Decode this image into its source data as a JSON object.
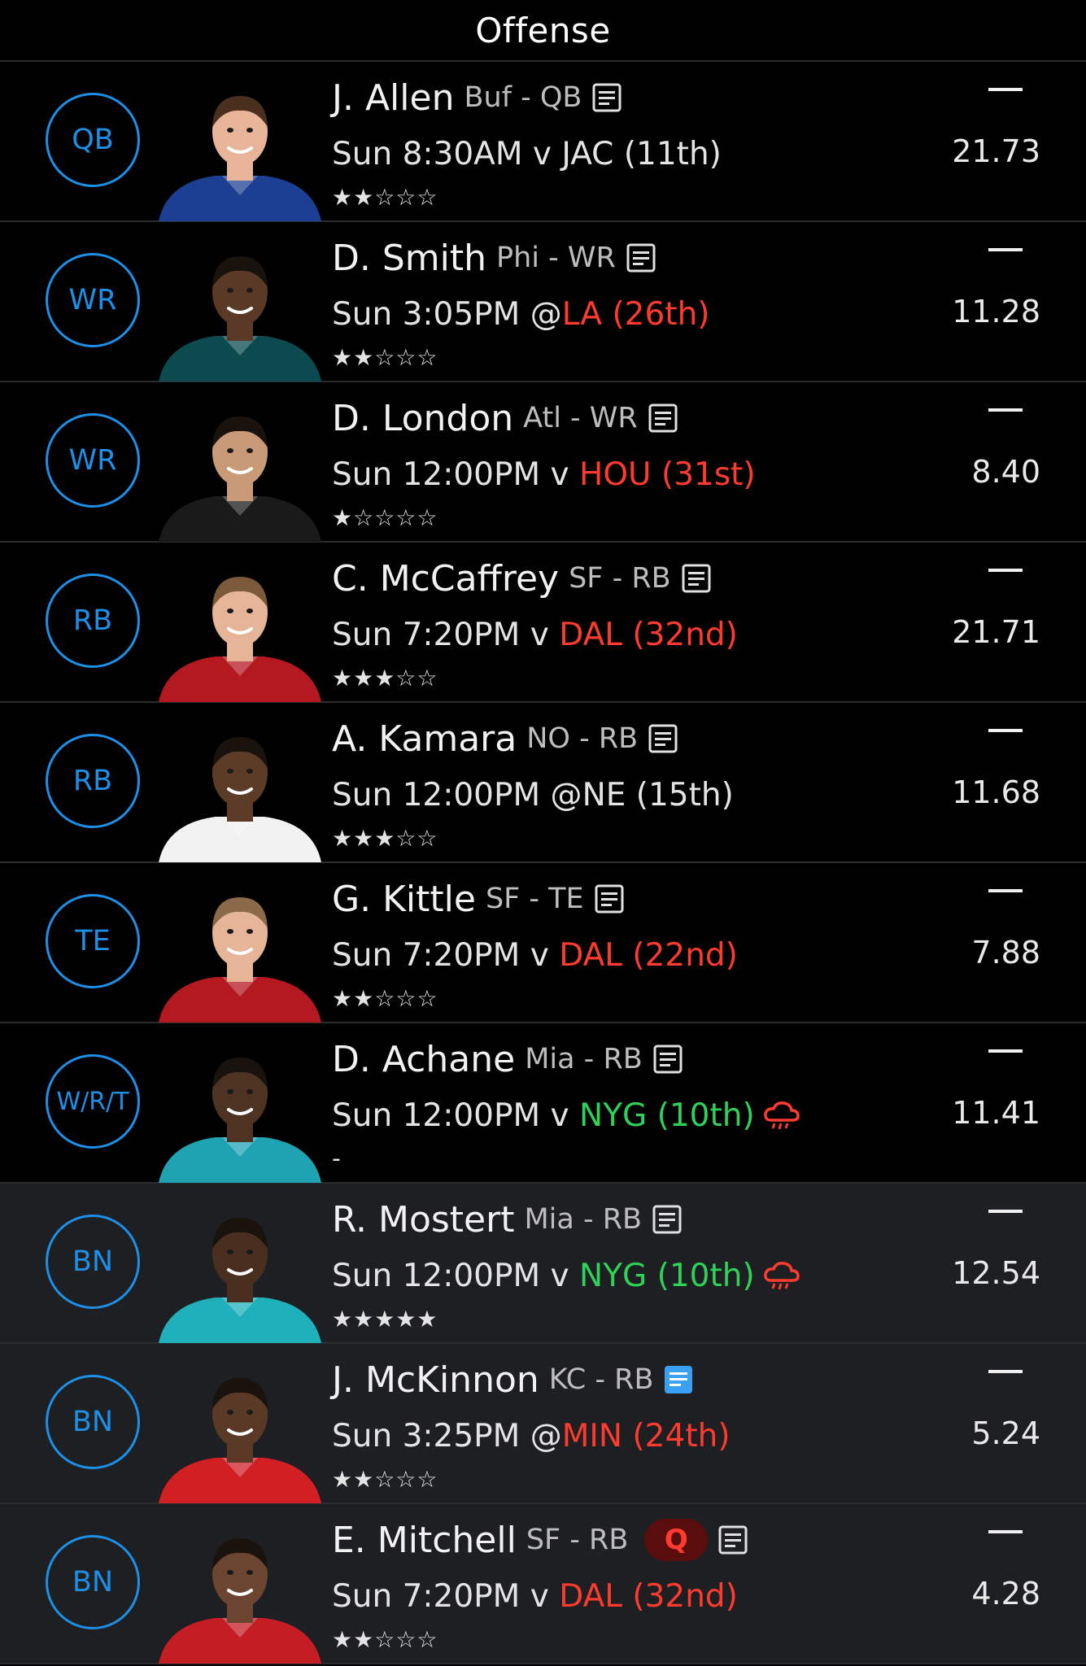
{
  "header": {
    "title": "Offense"
  },
  "rows": [
    {
      "pos": "QB",
      "name": "J. Allen",
      "meta": "Buf - QB",
      "time": "Sun 8:30AM",
      "sep": " v ",
      "opp": "JAC (11th)",
      "opp_color": "white",
      "stars": 2,
      "points": "21.73",
      "jersey": "#1c3f94",
      "skin": "#e8b59a",
      "hair": "#4a2f1e",
      "note_color": "#e0e0e0"
    },
    {
      "pos": "WR",
      "name": "D. Smith",
      "meta": "Phi - WR",
      "time": "Sun 3:05PM",
      "sep": " @",
      "opp": "LA (26th)",
      "opp_color": "red",
      "stars": 2,
      "points": "11.28",
      "jersey": "#0b4a4f",
      "skin": "#5a3a27",
      "hair": "#1a120d",
      "note_color": "#e0e0e0"
    },
    {
      "pos": "WR",
      "name": "D. London",
      "meta": "Atl - WR",
      "time": "Sun 12:00PM",
      "sep": " v ",
      "opp": "HOU (31st)",
      "opp_color": "red",
      "stars": 1,
      "points": "8.40",
      "jersey": "#1a1a1a",
      "skin": "#c99a77",
      "hair": "#1a120d",
      "note_color": "#e0e0e0"
    },
    {
      "pos": "RB",
      "name": "C. McCaffrey",
      "meta": "SF - RB",
      "time": "Sun 7:20PM",
      "sep": " v ",
      "opp": "DAL (32nd)",
      "opp_color": "red",
      "stars": 3,
      "points": "21.71",
      "jersey": "#b3191f",
      "skin": "#e6b497",
      "hair": "#7a5a3a",
      "note_color": "#e0e0e0"
    },
    {
      "pos": "RB",
      "name": "A. Kamara",
      "meta": "NO - RB",
      "time": "Sun 12:00PM",
      "sep": " @",
      "opp": "NE (15th)",
      "opp_color": "white",
      "stars": 3,
      "points": "11.68",
      "jersey": "#f2f2f2",
      "skin": "#5c3b27",
      "hair": "#1a120d",
      "note_color": "#e0e0e0"
    },
    {
      "pos": "TE",
      "name": "G. Kittle",
      "meta": "SF - TE",
      "time": "Sun 7:20PM",
      "sep": " v ",
      "opp": "DAL (22nd)",
      "opp_color": "red",
      "stars": 2,
      "points": "7.88",
      "jersey": "#b3191f",
      "skin": "#e6b497",
      "hair": "#8a6a48",
      "note_color": "#e0e0e0"
    },
    {
      "pos": "W/R/T",
      "name": "D. Achane",
      "meta": "Mia - RB",
      "time": "Sun 12:00PM",
      "sep": " v ",
      "opp": "NYG (10th)",
      "opp_color": "green",
      "weather": true,
      "stars": 0,
      "points": "11.41",
      "jersey": "#1fa3b3",
      "skin": "#4e3323",
      "hair": "#1a120d",
      "note_color": "#e0e0e0"
    },
    {
      "pos": "BN",
      "name": "R. Mostert",
      "meta": "Mia - RB",
      "time": "Sun 12:00PM",
      "sep": " v ",
      "opp": "NYG (10th)",
      "opp_color": "green",
      "weather": true,
      "stars": 5,
      "points": "12.54",
      "jersey": "#1fb0bc",
      "skin": "#4a2f20",
      "hair": "#1a120d",
      "note_color": "#e0e0e0",
      "bench": true
    },
    {
      "pos": "BN",
      "name": "J. McKinnon",
      "meta": "KC - RB",
      "time": "Sun 3:25PM",
      "sep": " @",
      "opp": "MIN (24th)",
      "opp_color": "red",
      "stars": 2,
      "points": "5.24",
      "jersey": "#d11f24",
      "skin": "#5a3a27",
      "hair": "#1a120d",
      "note_color": "#3aa0f2",
      "bench": true
    },
    {
      "pos": "BN",
      "name": "E. Mitchell",
      "meta": "SF - RB",
      "badge": "Q",
      "time": "Sun 7:20PM",
      "sep": " v ",
      "opp": "DAL (32nd)",
      "opp_color": "red",
      "stars": 2,
      "points": "4.28",
      "jersey": "#c51d24",
      "skin": "#6b4530",
      "hair": "#1a120d",
      "note_color": "#e0e0e0",
      "bench": true
    }
  ],
  "icons": {
    "note": "note-icon",
    "weather": "rain-cloud-icon",
    "star_filled": "★",
    "star_empty": "☆",
    "no_rating": "-"
  }
}
